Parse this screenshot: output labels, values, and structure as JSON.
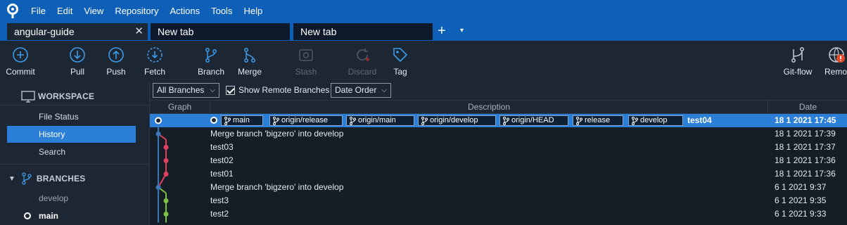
{
  "menu": [
    "File",
    "Edit",
    "View",
    "Repository",
    "Actions",
    "Tools",
    "Help"
  ],
  "tabs": [
    {
      "label": "angular-guide",
      "active": true,
      "close": "✕"
    },
    {
      "label": "New tab",
      "active": false
    },
    {
      "label": "New tab",
      "active": false
    }
  ],
  "tab_controls": {
    "add": "+",
    "menu": "▾"
  },
  "toolbar": {
    "commit": "Commit",
    "pull": "Pull",
    "push": "Push",
    "fetch": "Fetch",
    "branch": "Branch",
    "merge": "Merge",
    "stash": "Stash",
    "discard": "Discard",
    "tag": "Tag",
    "gitflow": "Git-flow",
    "remote": "Remote"
  },
  "sidebar": {
    "workspace_header": "WORKSPACE",
    "workspace_items": [
      {
        "label": "File Status",
        "selected": false
      },
      {
        "label": "History",
        "selected": true
      },
      {
        "label": "Search",
        "selected": false
      }
    ],
    "branches_header": "BRANCHES",
    "branches": [
      {
        "label": "develop",
        "current": false
      },
      {
        "label": "main",
        "current": true
      }
    ]
  },
  "filters": {
    "branches_dropdown": "All Branches",
    "show_remote_label": "Show Remote Branches",
    "show_remote_checked": true,
    "order_dropdown": "Date Order"
  },
  "columns": {
    "graph": "Graph",
    "description": "Description",
    "date": "Date"
  },
  "badges": [
    "main",
    "origin/release",
    "origin/main",
    "origin/develop",
    "origin/HEAD",
    "release",
    "develop"
  ],
  "commits": [
    {
      "message": "test04",
      "date": "18 1 2021 17:45",
      "selected": true
    },
    {
      "message": "Merge branch 'bigzero' into develop",
      "date": "18 1 2021 17:39"
    },
    {
      "message": "test03",
      "date": "18 1 2021 17:37"
    },
    {
      "message": "test02",
      "date": "18 1 2021 17:36"
    },
    {
      "message": "test01",
      "date": "18 1 2021 17:36"
    },
    {
      "message": "Merge branch 'bigzero' into develop",
      "date": "6 1 2021 9:37"
    },
    {
      "message": "test3",
      "date": "6 1 2021 9:35"
    },
    {
      "message": "test2",
      "date": "6 1 2021 9:33"
    }
  ],
  "colors": {
    "accent": "#0d5fb7",
    "selection": "#2b7fd6",
    "graph_blue": "#3a78b8",
    "graph_red": "#e0405e",
    "graph_green": "#7cc242"
  }
}
